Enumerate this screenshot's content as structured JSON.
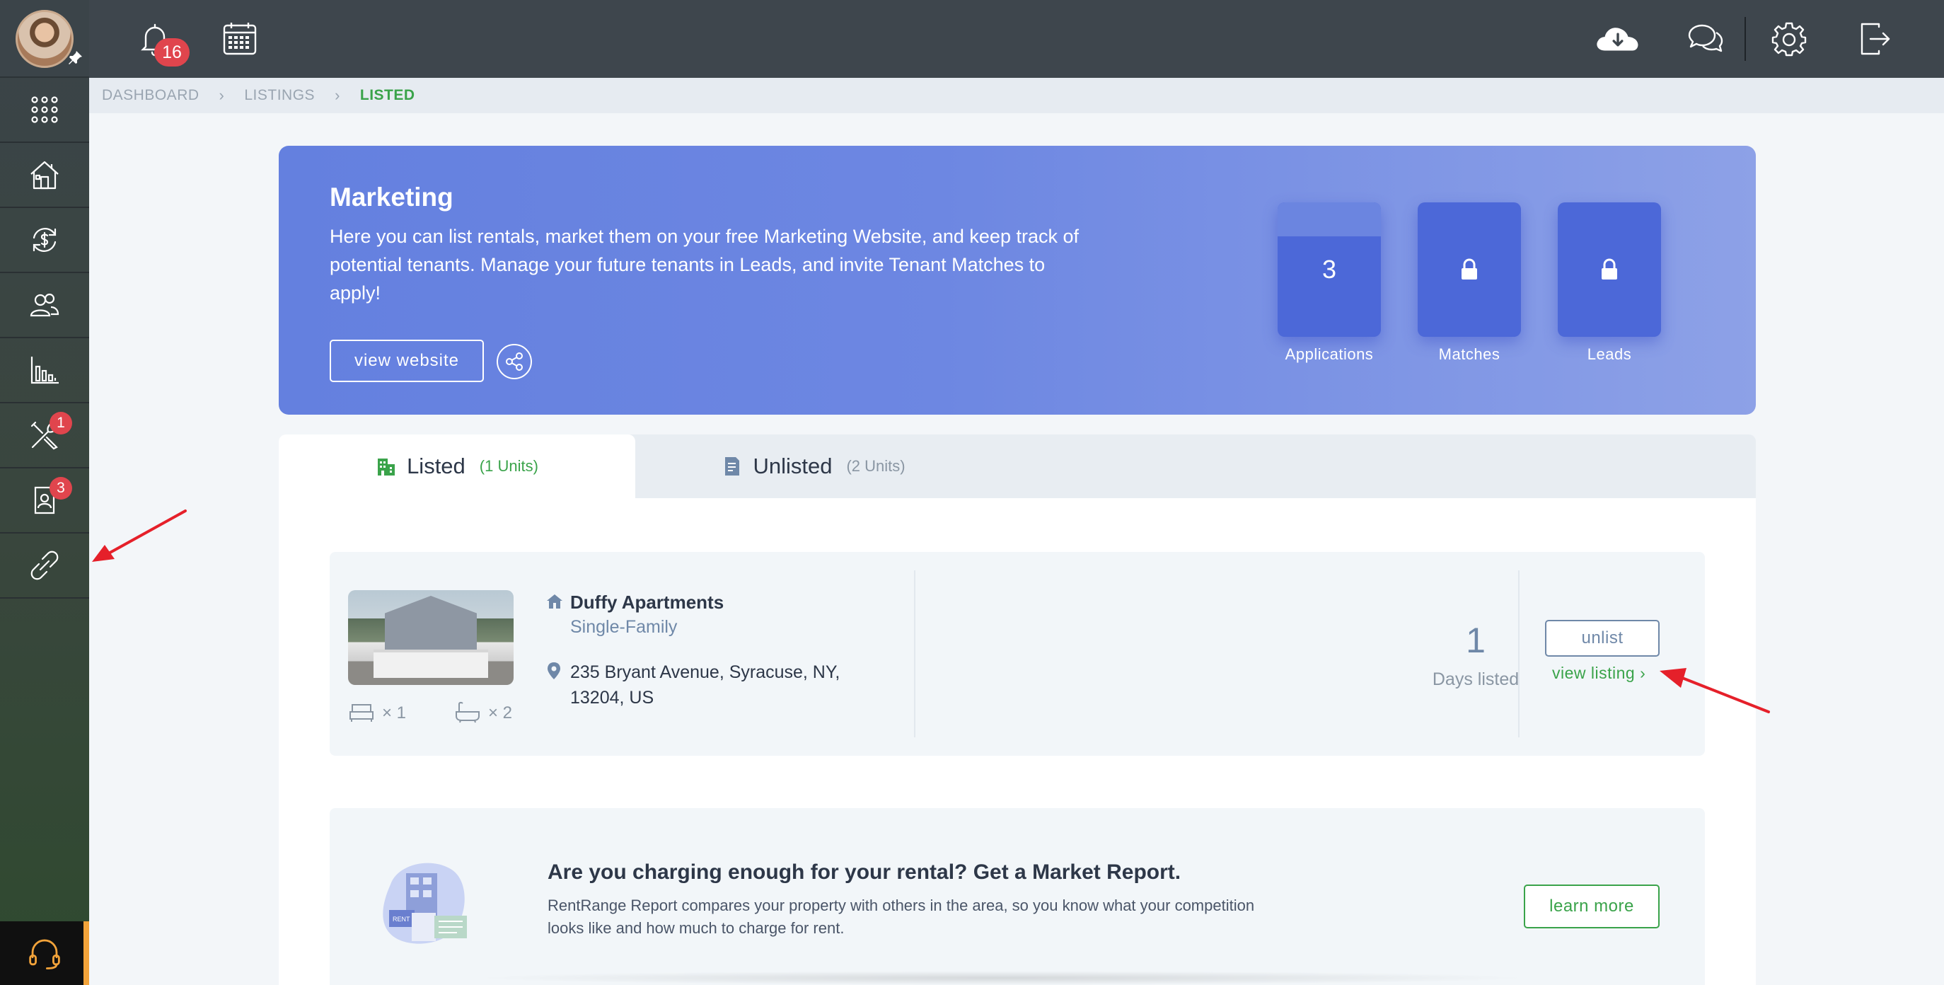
{
  "topbar": {
    "notification_count": "16",
    "icons": [
      "bell-icon",
      "calendar-icon",
      "cloud-download-icon",
      "chat-icon",
      "gear-icon",
      "logout-icon"
    ]
  },
  "sidebar": {
    "items": [
      {
        "name": "apps-grid-icon",
        "badge": ""
      },
      {
        "name": "properties-icon",
        "badge": ""
      },
      {
        "name": "accounting-icon",
        "badge": ""
      },
      {
        "name": "people-icon",
        "badge": ""
      },
      {
        "name": "reports-icon",
        "badge": ""
      },
      {
        "name": "maintenance-icon",
        "badge": "1"
      },
      {
        "name": "applicants-icon",
        "badge": "3"
      },
      {
        "name": "integrations-link-icon",
        "badge": ""
      }
    ],
    "support_icon": "headset-icon"
  },
  "breadcrumb": {
    "items": [
      "DASHBOARD",
      "LISTINGS",
      "LISTED"
    ]
  },
  "banner": {
    "title": "Marketing",
    "text": "Here you can list rentals, market them on your free Marketing Website, and keep track of potential tenants. Manage your future tenants in Leads, and invite Tenant Matches to apply!",
    "website_button": "view website",
    "stats": [
      {
        "label": "Applications",
        "value": "3"
      },
      {
        "label": "Matches",
        "value": "",
        "locked": true
      },
      {
        "label": "Leads",
        "value": "",
        "locked": true
      }
    ]
  },
  "tabs": [
    {
      "label": "Listed",
      "count": "(1 Units)"
    },
    {
      "label": "Unlisted",
      "count": "(2 Units)"
    }
  ],
  "listing": {
    "name": "Duffy Apartments",
    "type": "Single-Family",
    "address": "235 Bryant Avenue, Syracuse, NY, 13204, US",
    "beds": "× 1",
    "baths": "× 2",
    "days_listed": "1",
    "days_label": "Days listed",
    "unlist_button": "unlist",
    "view_listing": "view listing ›"
  },
  "report": {
    "title": "Are you charging enough for your rental? Get a Market Report.",
    "text": "RentRange Report compares your property with others in the area, so you know what your competition looks like and how much to charge for rent.",
    "learn_more": "learn more",
    "illustration_sign": "RENT"
  },
  "colors": {
    "accent_green": "#3aa34a",
    "banner_blue": "#6480df",
    "badge_red": "#e0454d",
    "annotation_red": "#e5202a"
  }
}
